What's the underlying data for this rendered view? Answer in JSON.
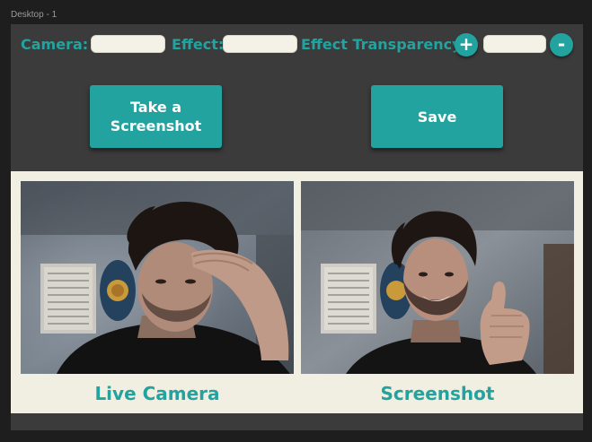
{
  "frame": {
    "title": "Desktop - 1"
  },
  "controls": {
    "camera_label": "Camera:",
    "camera_value": "",
    "effect_label": "Effect:",
    "effect_value": "",
    "transparency_label": "Effect Transparency:",
    "transparency_value": "",
    "increase_symbol": "+",
    "decrease_symbol": "-"
  },
  "actions": {
    "screenshot_label": "Take a\nScreenshot",
    "save_label": "Save"
  },
  "previews": {
    "live_caption": "Live Camera",
    "screenshot_caption": "Screenshot"
  },
  "colors": {
    "accent": "#22a39f",
    "frame_bg": "#3b3b3b",
    "panel_bg": "#f1eee2",
    "canvas_bg": "#1e1e1e"
  },
  "icons": {
    "increase": "plus-icon",
    "decrease": "minus-icon"
  }
}
